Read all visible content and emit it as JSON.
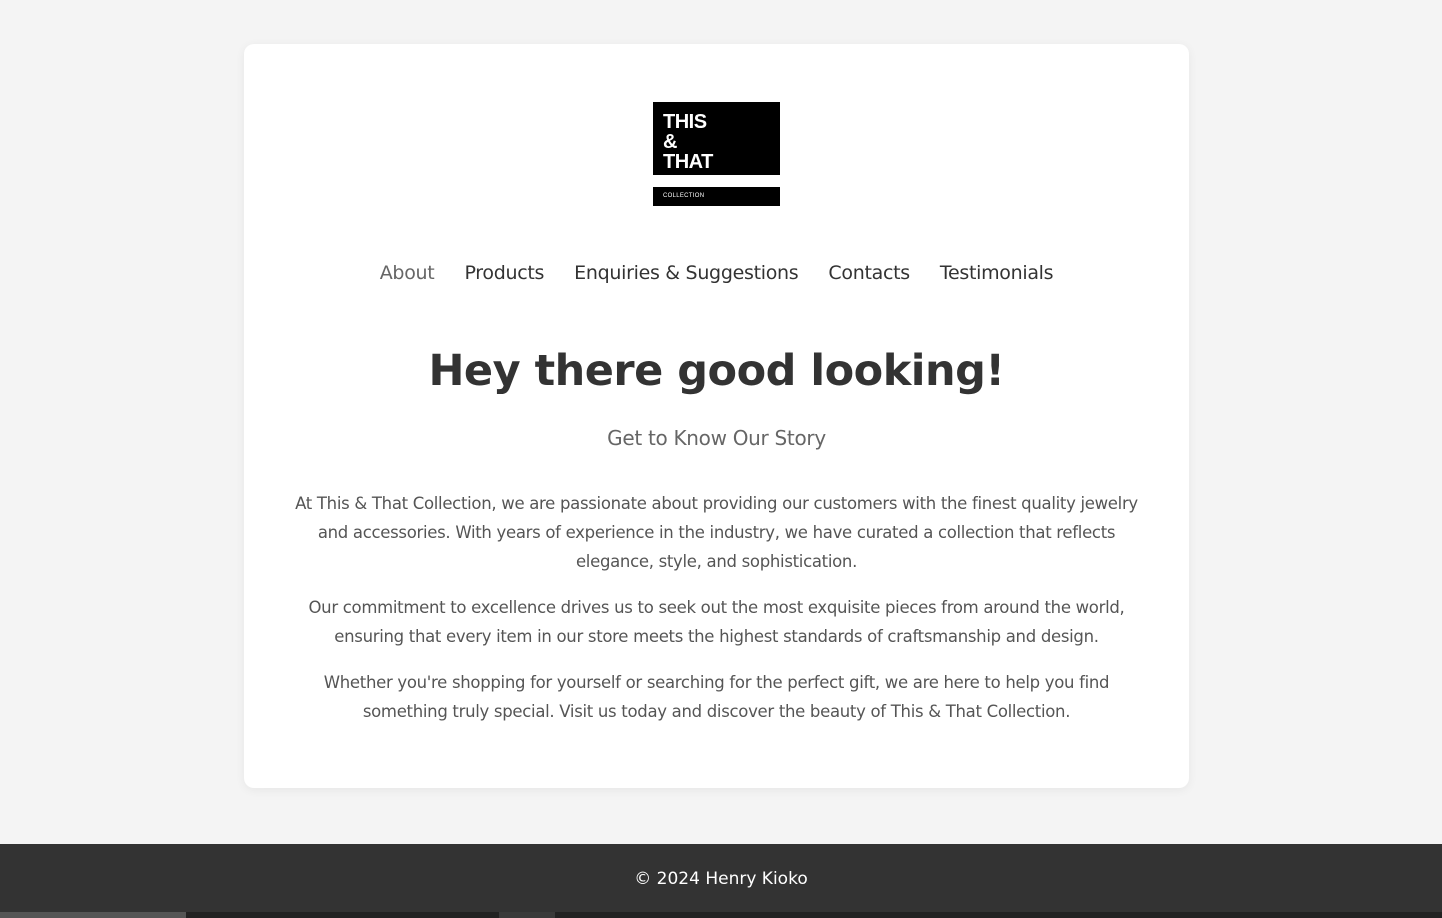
{
  "logo": {
    "line1": "THIS",
    "line2": "&",
    "line3": "THAT",
    "sub": "COLLECTION"
  },
  "nav": {
    "items": [
      {
        "label": "About",
        "active": true
      },
      {
        "label": "Products"
      },
      {
        "label": "Enquiries & Suggestions"
      },
      {
        "label": "Contacts"
      },
      {
        "label": "Testimonials"
      }
    ]
  },
  "hero": {
    "title": "Hey there good looking!",
    "subtitle": "Get to Know Our Story"
  },
  "content": {
    "paragraphs": [
      "At This & That Collection, we are passionate about providing our customers with the finest quality jewelry and accessories. With years of experience in the industry, we have curated a collection that reflects elegance, style, and sophistication.",
      "Our commitment to excellence drives us to seek out the most exquisite pieces from around the world, ensuring that every item in our store meets the highest standards of craftsmanship and design.",
      "Whether you're shopping for yourself or searching for the perfect gift, we are here to help you find something truly special. Visit us today and discover the beauty of This & That Collection."
    ]
  },
  "footer": {
    "text": "© 2024 Henry Kioko"
  },
  "colors": {
    "background": "#f4f4f4",
    "card": "#ffffff",
    "footer": "#333333",
    "text": "#333333",
    "muted": "#666666"
  }
}
